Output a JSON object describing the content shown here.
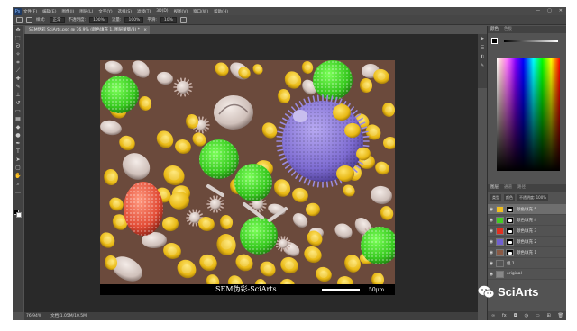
{
  "menubar": {
    "app_icon": "Ps",
    "items": [
      "文件(F)",
      "编辑(E)",
      "图像(I)",
      "图层(L)",
      "文字(Y)",
      "选择(S)",
      "滤镜(T)",
      "3D(D)",
      "视图(V)",
      "窗口(W)",
      "帮助(H)"
    ],
    "window_buttons": [
      "—",
      "▢",
      "✕"
    ]
  },
  "options_bar": {
    "items": [
      "样式:",
      "正常",
      "不透明度:",
      "100%",
      "流量:",
      "100%",
      "平滑:",
      "10%"
    ]
  },
  "document": {
    "tab_title": "SEM伪彩 SciArts.psd @ 76.9% (颜色填充 1, 图层蒙版/8) *",
    "close": "×",
    "caption": "SEM伪彩-SciArts",
    "scale_label": "50μm"
  },
  "status_bar": {
    "zoom": "76.94%",
    "doc_info": "文档:1.05M/10.5M"
  },
  "color_panel": {
    "tabs": [
      "颜色",
      "色板"
    ]
  },
  "layers_panel": {
    "tabs": [
      "图层",
      "通道",
      "路径"
    ],
    "kind_label": "类型",
    "blend_mode": "颜色",
    "opacity": "不透明度: 100%",
    "fill": "填充: 100%",
    "layers": [
      {
        "name": "颜色填充 5",
        "color": "#f0c020",
        "has_mask": true,
        "selected": true
      },
      {
        "name": "颜色填充 4",
        "color": "#44cc22",
        "has_mask": true,
        "selected": false
      },
      {
        "name": "颜色填充 3",
        "color": "#e03020",
        "has_mask": true,
        "selected": false
      },
      {
        "name": "颜色填充 2",
        "color": "#7060d0",
        "has_mask": true,
        "selected": false
      },
      {
        "name": "颜色填充 1",
        "color": "#8a5a45",
        "has_mask": true,
        "selected": false
      },
      {
        "name": "组 1",
        "color": "#555555",
        "has_mask": false,
        "selected": false
      },
      {
        "name": "original",
        "color": "#888888",
        "has_mask": false,
        "selected": false
      }
    ]
  },
  "watermark": {
    "text": "SciArts",
    "icon": "wechat-icon"
  },
  "colors": {
    "background_tissue": "#6b4a3c",
    "pollen_green": "#3fd22a",
    "pollen_yellow": "#f2c420",
    "pollen_purple": "#8a7ad8",
    "pollen_red": "#e85540",
    "pollen_white": "#d8cfcc"
  }
}
